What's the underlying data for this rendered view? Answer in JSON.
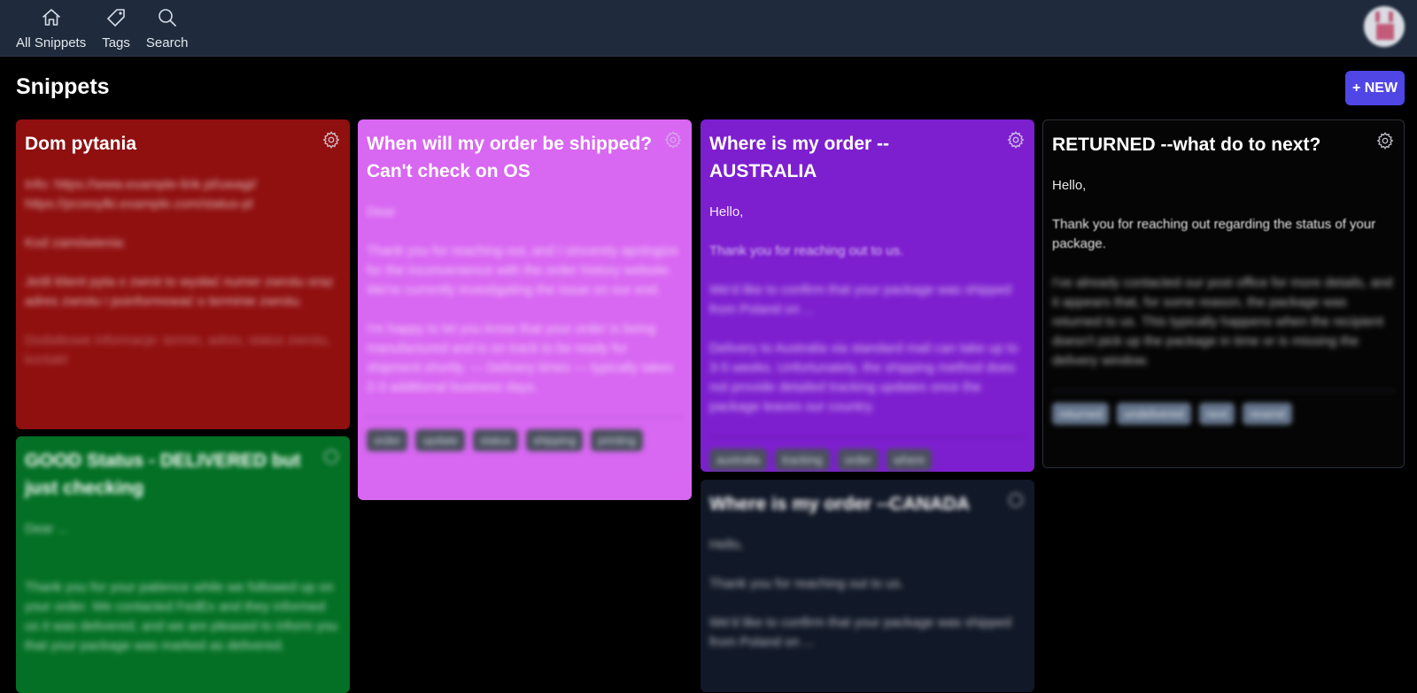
{
  "nav": {
    "items": [
      {
        "label": "All Snippets",
        "icon": "home-icon"
      },
      {
        "label": "Tags",
        "icon": "tag-icon"
      },
      {
        "label": "Search",
        "icon": "search-icon"
      }
    ],
    "avatar": "user-avatar"
  },
  "page": {
    "title": "Snippets",
    "new_button_label": "+ NEW",
    "accent_color": "#5046e5"
  },
  "cards": [
    {
      "title": "Dom pytania",
      "color": "#901010",
      "body": [
        "Info: https://www.example-link.pl/uwagi/ https://przesylki.example.com/status-pl",
        "Kod zamówienia:",
        "Jeśli klient pyta o zwrot to wysłać numer zwrotu oraz adres zwrotu i poinformować o terminie zwrotu.",
        "Dodatkowe informacje: termin, adres, status zwrotu, kontakt"
      ],
      "tags": []
    },
    {
      "title": "When will my order be shipped? Can't check on OS",
      "color": "#d867f2",
      "body": [
        "Dear",
        "Thank you for reaching out, and I sincerely apologize for the inconvenience with the order history website. We're currently investigating the issue on our end.",
        "I'm happy to let you know that your order is being manufactured and is on track to be ready for shipment shortly. — Delivery times — typically takes 2-3 additional business days."
      ],
      "tags": [
        "order",
        "update",
        "status",
        "shipping",
        "printing"
      ]
    },
    {
      "title": "Where is my order --AUSTRALIA",
      "color": "#7d1fcf",
      "body": [
        "Hello,",
        "Thank you for reaching out to us.",
        "We'd like to confirm that your package was shipped from Poland on ...",
        "Delivery to Australia via standard mail can take up to 3-5 weeks. Unfortunately, the shipping method does not provide detailed tracking updates once the package leaves our country."
      ],
      "tags": [
        "australia",
        "tracking",
        "order",
        "where"
      ]
    },
    {
      "title": "RETURNED --what do to next?",
      "color": "#050505",
      "body": [
        "Hello,",
        "Thank you for reaching out regarding the status of your package.",
        "I've already contacted our post office for more details, and it appears that, for some reason, the package was returned to us. This typically happens when the recipient doesn't pick up the package in time or is missing the delivery window."
      ],
      "tags": [
        "returned",
        "undelivered",
        "next",
        "resend"
      ]
    },
    {
      "title": "GOOD Status - DELIVERED but just checking",
      "color": "#037025",
      "body": [
        "Dear ...",
        "Thank you for your patience while we followed up on your order. We contacted FedEx and they informed us it was delivered, and we are pleased to inform you that your package was marked as delivered."
      ],
      "tags": []
    },
    {
      "title": "Where is my order --CANADA",
      "color": "#111827",
      "body": [
        "Hello,",
        "Thank you for reaching out to us.",
        "We'd like to confirm that your package was shipped from Poland on ..."
      ],
      "tags": []
    }
  ]
}
